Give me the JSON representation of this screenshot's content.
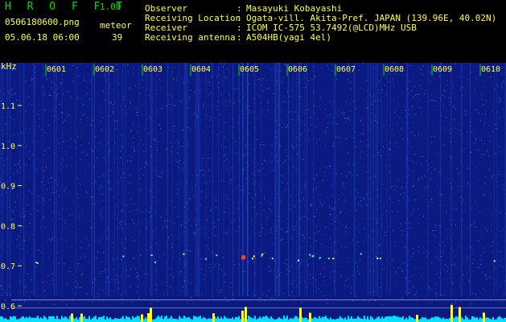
{
  "header": {
    "app_title": "H R O F F T",
    "version": "1.00",
    "filename": "0506180600.png",
    "datetime": "05.06.18 06:00",
    "meteor_label": "meteor",
    "meteor_count": "39",
    "fields": [
      {
        "label": "Observer",
        "value": "Masayuki Kobayashi"
      },
      {
        "label": "Receiving Location",
        "value": "Ogata-vill. Akita-Pref. JAPAN (139.96E, 40.02N)"
      },
      {
        "label": "Receiver",
        "value": "ICOM IC-575 53.7492(@LCD)MHz USB"
      },
      {
        "label": "Receiving antenna",
        "value": "A504HB(yagi 4el)"
      }
    ],
    "colon": ":"
  },
  "spectrogram": {
    "unit_label": "kHz",
    "y_ticks": [
      "1.1",
      "1.0",
      "0.9",
      "0.8",
      "0.7",
      "0.6"
    ],
    "y_values": [
      1.1,
      1.0,
      0.9,
      0.8,
      0.7,
      0.6
    ],
    "time_labels": [
      "0601",
      "0602",
      "0603",
      "0604",
      "0605",
      "0606",
      "0607",
      "0608",
      "0609",
      "0610"
    ],
    "colors": {
      "background": "#0a1a80",
      "noise": "#2850e0",
      "label": "#ffff40",
      "tick": "#00e000",
      "trace": "#00e0ff",
      "peak": "#ffff00"
    }
  }
}
